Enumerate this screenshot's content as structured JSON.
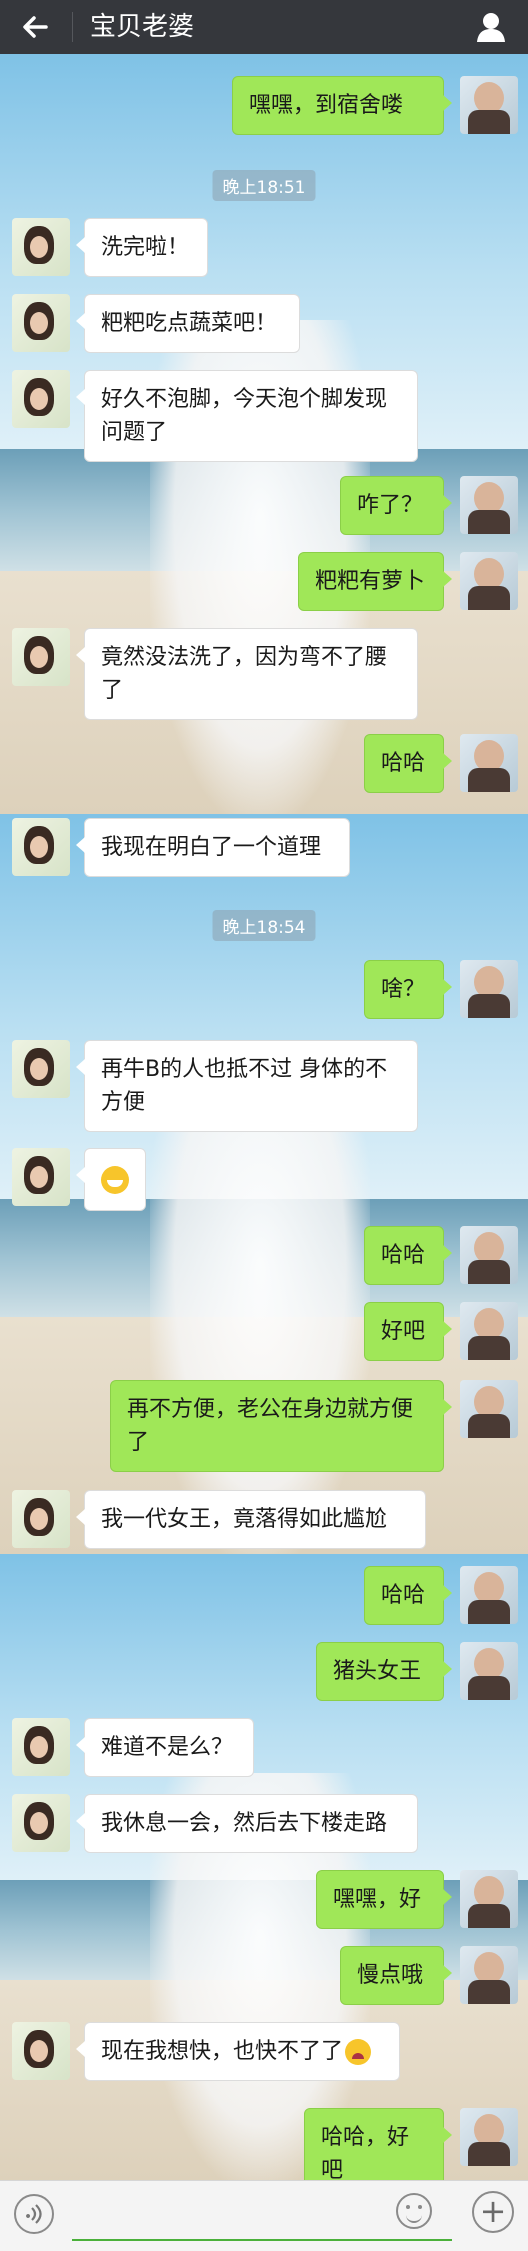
{
  "header": {
    "title": "宝贝老婆",
    "back_icon": "arrow-left-icon",
    "profile_icon": "person-icon"
  },
  "messages": [
    {
      "side": "right",
      "text": "嘿嘿，到宿舍喽"
    },
    {
      "type": "time",
      "text": "晚上18:51"
    },
    {
      "side": "left",
      "text": "洗完啦！"
    },
    {
      "side": "left",
      "text": "粑粑吃点蔬菜吧！"
    },
    {
      "side": "left",
      "text": "好久不泡脚，今天泡个脚发现\n问题了"
    },
    {
      "side": "right",
      "text": "咋了？"
    },
    {
      "side": "right",
      "text": "粑粑有萝卜"
    },
    {
      "side": "left",
      "text": "竟然没法洗了，因为弯不了腰\n了"
    },
    {
      "side": "right",
      "text": "哈哈"
    },
    {
      "side": "left",
      "text": "我现在明白了一个道理"
    },
    {
      "type": "time",
      "text": "晚上18:54"
    },
    {
      "side": "right",
      "text": "啥？"
    },
    {
      "side": "left",
      "text": "再牛B的人也抵不过 身体的不\n方便"
    },
    {
      "side": "left",
      "text": "",
      "emoji": "grin-emoji"
    },
    {
      "side": "right",
      "text": "哈哈"
    },
    {
      "side": "right",
      "text": "好吧"
    },
    {
      "side": "right",
      "text": "再不方便，老公在身边就方便\n了"
    },
    {
      "side": "left",
      "text": "我一代女王，竟落得如此尴尬"
    },
    {
      "side": "right",
      "text": "哈哈"
    },
    {
      "side": "right",
      "text": "猪头女王"
    },
    {
      "side": "left",
      "text": "难道不是么？"
    },
    {
      "side": "left",
      "text": "我休息一会，然后去下楼走路"
    },
    {
      "side": "right",
      "text": "嘿嘿，好"
    },
    {
      "side": "right",
      "text": "慢点哦"
    },
    {
      "side": "left",
      "text": "现在我想快，也快不了了",
      "emoji": "crying-emoji"
    },
    {
      "side": "right",
      "text": "哈哈，好吧"
    }
  ],
  "input_bar": {
    "voice_icon": "voice-icon",
    "input_value": "",
    "emoji_icon": "smiley-icon",
    "more_icon": "plus-icon"
  }
}
